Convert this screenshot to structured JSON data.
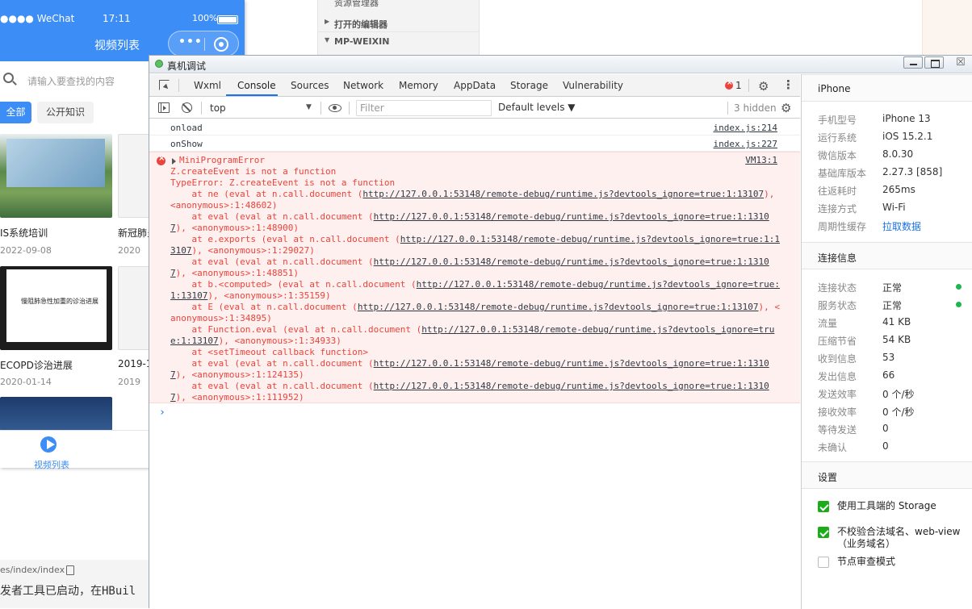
{
  "phone": {
    "carrier": "●●●● WeChat",
    "time": "17:11",
    "battery": "100%",
    "title": "视频列表",
    "capsule_dots": "•••",
    "search_placeholder": "请输入要查找的内容",
    "chips": [
      "全部",
      "公开知识"
    ],
    "videos": [
      {
        "title": "IS系统培训",
        "date": "2022-09-08"
      },
      {
        "title": "新冠肺炎",
        "date": "2020"
      },
      {
        "title": "ECOPD诊治进展",
        "date": "2020-01-14",
        "slide_text": "慢阻肺急性加重的诊治进展"
      },
      {
        "title": "2019-1",
        "date": "2019"
      }
    ],
    "tab_label": "视频列表",
    "path": "es/index/index",
    "console_text": "发者工具已启动，在HBuil"
  },
  "explorer": {
    "top_label": "资源管理器",
    "more": "···",
    "sections": [
      "打开的编辑器",
      "MP-WEIXIN"
    ]
  },
  "devtools": {
    "window_title": "真机调试",
    "close_glyph": "☒",
    "tabs": [
      "Wxml",
      "Console",
      "Sources",
      "Network",
      "Memory",
      "AppData",
      "Storage",
      "Vulnerability"
    ],
    "error_count": "1",
    "toolbar": {
      "context": "top",
      "filter_placeholder": "Filter",
      "levels": "Default levels ▼",
      "hidden": "3 hidden"
    },
    "logs": [
      {
        "text": "onload",
        "source": "index.js:214"
      },
      {
        "text": "onShow",
        "source": "index.js:227"
      }
    ],
    "error": {
      "header": "MiniProgramError",
      "source": "VM13:1",
      "lines": [
        {
          "t": "Z.createEvent is not a function"
        },
        {
          "t": "TypeError: Z.createEvent is not a function"
        },
        {
          "t": "    at ne (eval at n.call.document (",
          "u": "http://127.0.0.1:53148/remote-debug/runtime.js?devtools_ignore=true:1:13107",
          "e": "), <anonymous>:1:48602)"
        },
        {
          "t": "    at eval (eval at n.call.document (",
          "u": "http://127.0.0.1:53148/remote-debug/runtime.js?devtools_ignore=true:1:13107",
          "e": "), <anonymous>:1:48900)"
        },
        {
          "t": "    at e.exports (eval at n.call.document (",
          "u": "http://127.0.0.1:53148/remote-debug/runtime.js?devtools_ignore=true:1:13107",
          "e": "), <anonymous>:1:29027)"
        },
        {
          "t": "    at eval (eval at n.call.document (",
          "u": "http://127.0.0.1:53148/remote-debug/runtime.js?devtools_ignore=true:1:13107",
          "e": "), <anonymous>:1:48851)"
        },
        {
          "t": "    at b.<computed> (eval at n.call.document (",
          "u": "http://127.0.0.1:53148/remote-debug/runtime.js?devtools_ignore=true:1:13107",
          "e": "), <anonymous>:1:35159)"
        },
        {
          "t": "    at E (eval at n.call.document (",
          "u": "http://127.0.0.1:53148/remote-debug/runtime.js?devtools_ignore=true:1:13107",
          "e": "), <anonymous>:1:34895)"
        },
        {
          "t": "    at Function.eval (eval at n.call.document (",
          "u": "http://127.0.0.1:53148/remote-debug/runtime.js?devtools_ignore=true:1:13107",
          "e": "), <anonymous>:1:34933)"
        },
        {
          "t": "    at <setTimeout callback function>"
        },
        {
          "t": "    at eval (eval at n.call.document (",
          "u": "http://127.0.0.1:53148/remote-debug/runtime.js?devtools_ignore=true:1:13107",
          "e": "), <anonymous>:1:124135)"
        },
        {
          "t": "    at eval (eval at n.call.document (",
          "u": "http://127.0.0.1:53148/remote-debug/runtime.js?devtools_ignore=true:1:13107",
          "e": "), <anonymous>:1:111952)"
        }
      ]
    },
    "prompt": "›"
  },
  "sidepanel": {
    "device_title": "iPhone",
    "device_info": [
      {
        "key": "手机型号",
        "value": "iPhone 13"
      },
      {
        "key": "运行系统",
        "value": "iOS 15.2.1"
      },
      {
        "key": "微信版本",
        "value": "8.0.30"
      },
      {
        "key": "基础库版本",
        "value": "2.27.3 [858]"
      },
      {
        "key": "往返耗时",
        "value": "265ms"
      },
      {
        "key": "连接方式",
        "value": "Wi-Fi"
      },
      {
        "key": "周期性缓存",
        "value": "拉取数据",
        "link": true
      }
    ],
    "conn_title": "连接信息",
    "conn_info": [
      {
        "key": "连接状态",
        "value": "正常",
        "dot": true
      },
      {
        "key": "服务状态",
        "value": "正常",
        "dot": true
      },
      {
        "key": "流量",
        "value": "41 KB"
      },
      {
        "key": "压缩节省",
        "value": "54 KB"
      },
      {
        "key": "收到信息",
        "value": "53"
      },
      {
        "key": "发出信息",
        "value": "66"
      },
      {
        "key": "发送效率",
        "value": "0 个/秒"
      },
      {
        "key": "接收效率",
        "value": "0 个/秒"
      },
      {
        "key": "等待发送",
        "value": "0"
      },
      {
        "key": "未确认",
        "value": "0"
      }
    ],
    "settings_title": "设置",
    "settings": [
      {
        "label": "使用工具端的 Storage",
        "checked": true
      },
      {
        "label": "不校验合法域名、web-view（业务域名）",
        "checked": true
      },
      {
        "label": "节点审查模式",
        "checked": false
      }
    ]
  },
  "colors": {
    "accent": "#1a73e8",
    "error": "#e8453c",
    "wechat_blue": "#3c8df6",
    "check_green": "#1aad19",
    "status_green": "#23b44d"
  }
}
